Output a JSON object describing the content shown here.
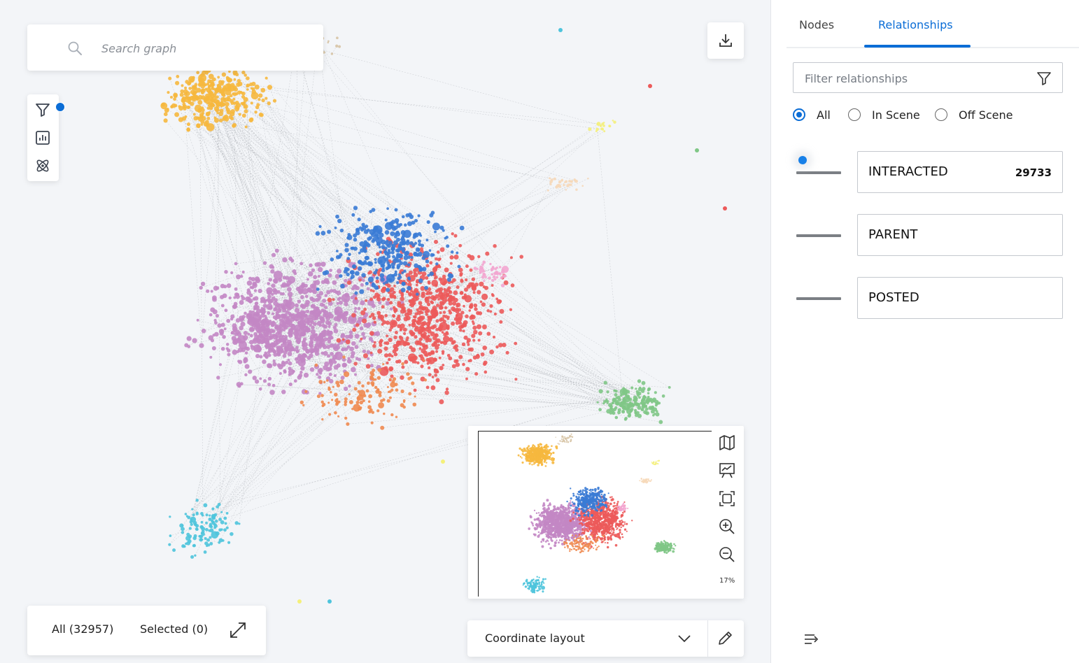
{
  "search": {
    "placeholder": "Search graph"
  },
  "toolbar": {
    "tools": [
      "filter-icon",
      "chart-icon",
      "atom-icon"
    ],
    "filter_active_color": "#0b6dd6",
    "download_icon": "download-icon"
  },
  "status": {
    "all_label": "All (32957)",
    "selected_label": "Selected (0)",
    "expand_icon": "expand-icon"
  },
  "minimap": {
    "controls": [
      "map-icon",
      "presentation-icon",
      "fit-screen-icon",
      "zoom-in-icon",
      "zoom-out-icon"
    ],
    "zoom_level": "17%"
  },
  "layout": {
    "selected": "Coordinate layout",
    "edit_icon": "pencil-icon"
  },
  "panel": {
    "tabs": [
      {
        "label": "Nodes",
        "active": false
      },
      {
        "label": "Relationships",
        "active": true
      }
    ],
    "filter_placeholder": "Filter relationships",
    "scope_options": [
      {
        "label": "All",
        "checked": true
      },
      {
        "label": "In Scene",
        "checked": false
      },
      {
        "label": "Off Scene",
        "checked": false
      }
    ],
    "relationships": [
      {
        "name": "INTERACTED",
        "count": "29733",
        "selected": true
      },
      {
        "name": "PARENT",
        "count": ""
      },
      {
        "name": "POSTED",
        "count": ""
      }
    ]
  },
  "graph_colors": {
    "orange": "#f6b83e",
    "tan": "#d7c4a5",
    "blue": "#3a7bd5",
    "red": "#ec5a5a",
    "purple": "#c387c4",
    "coral": "#f08a50",
    "green": "#7fc786",
    "cyan": "#4ec4dc",
    "pink": "#f3a6d0",
    "yellow": "#f4f07a",
    "peach": "#f6d8b8",
    "edge": "#7a7f86"
  }
}
